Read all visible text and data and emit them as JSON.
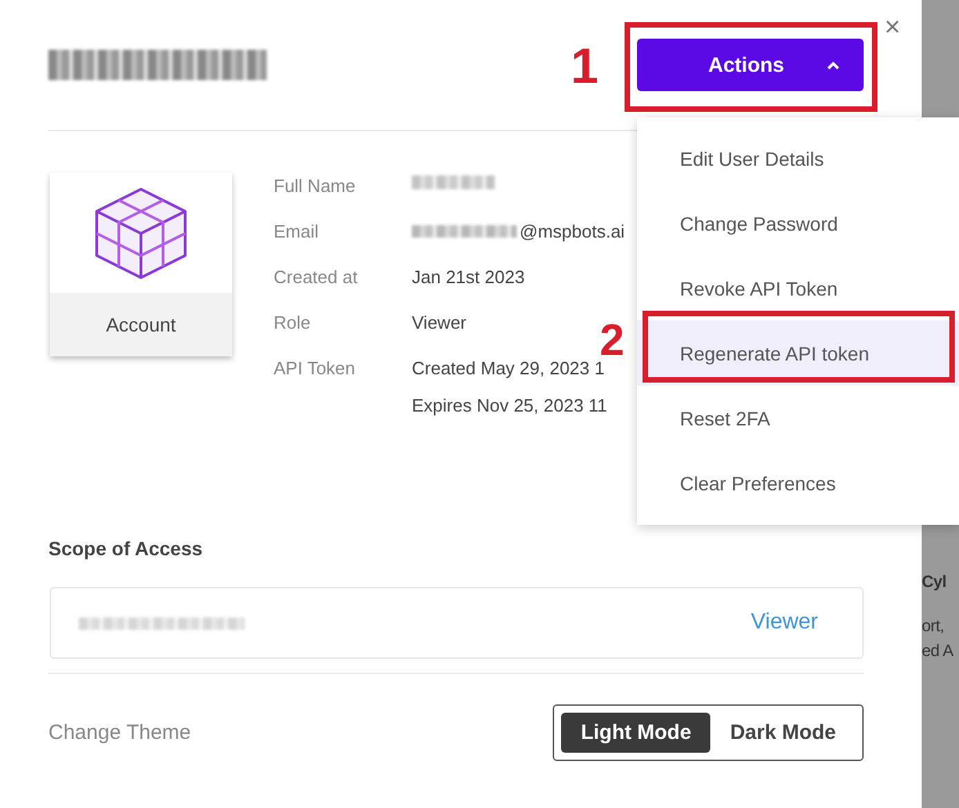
{
  "dialog": {
    "close": "×",
    "actions_button": {
      "label": "Actions",
      "expanded": true
    },
    "account_card": {
      "label": "Account"
    },
    "details": [
      {
        "label": "Full Name",
        "kind": "redacted"
      },
      {
        "label": "Email",
        "kind": "email",
        "value": "@mspbots.ai"
      },
      {
        "label": "Created at",
        "kind": "text",
        "value": "Jan 21st 2023"
      },
      {
        "label": "Role",
        "kind": "text",
        "value": "Viewer"
      },
      {
        "label": "API Token",
        "kind": "lines",
        "lines": [
          "Created May 29, 2023 1",
          "Expires Nov 25, 2023 11"
        ]
      }
    ],
    "scope": {
      "title": "Scope of Access",
      "role": "Viewer"
    },
    "theme": {
      "label": "Change Theme",
      "options": [
        {
          "label": "Light Mode",
          "selected": true
        },
        {
          "label": "Dark Mode",
          "selected": false
        }
      ]
    }
  },
  "actions_menu": {
    "items": [
      {
        "label": "Edit User Details",
        "selected": false
      },
      {
        "label": "Change Password",
        "selected": false
      },
      {
        "label": "Revoke API Token",
        "selected": false
      },
      {
        "label": "Regenerate API token",
        "selected": true
      },
      {
        "label": "Reset 2FA",
        "selected": false
      },
      {
        "label": "Clear Preferences",
        "selected": false
      }
    ]
  },
  "annotations": {
    "actions_step": "1",
    "menu_step": "2"
  },
  "background": {
    "texts": [
      "Cyl",
      "ort,",
      "ed A"
    ]
  }
}
